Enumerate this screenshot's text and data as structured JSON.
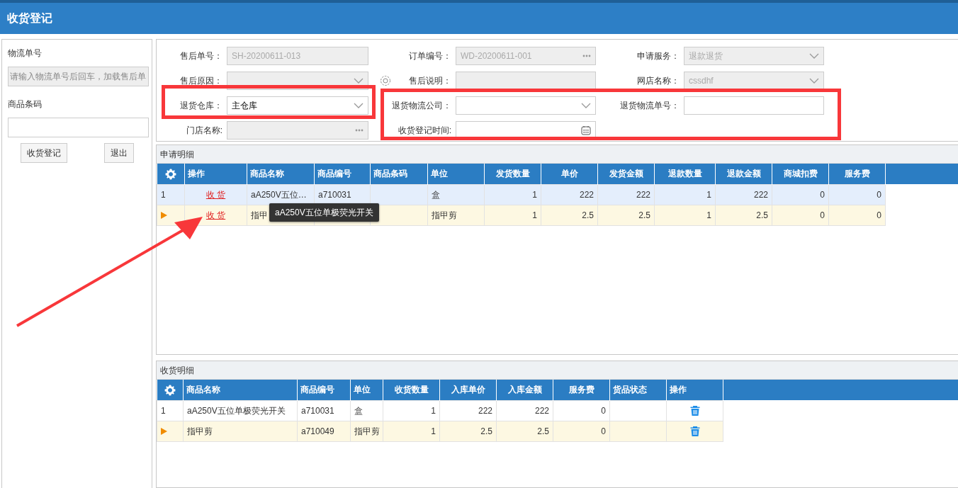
{
  "window": {
    "title": "收货登记"
  },
  "sidebar": {
    "fields": [
      {
        "label": "物流单号",
        "placeholder": "请输入物流单号后回车，加载售后单",
        "disabled": true
      },
      {
        "label": "商品条码",
        "disabled": false
      }
    ],
    "buttons": [
      "收货登记",
      "退出"
    ]
  },
  "form": {
    "fields": [
      {
        "label": "售后单号：",
        "kind": "text",
        "value": "SH-20200611-013",
        "disabled": true
      },
      {
        "label": "订单编号：",
        "kind": "lookup",
        "value": "WD-20200611-001",
        "disabled": true
      },
      {
        "label": "申请服务：",
        "kind": "select",
        "value": "退款退货",
        "disabled": true
      },
      {
        "label": "售后原因：",
        "kind": "select",
        "disabled": true
      },
      {
        "label": "售后说明：",
        "kind": "text",
        "disabled": true,
        "settings": true
      },
      {
        "label": "网店名称：",
        "kind": "select",
        "value": "cssdhf",
        "disabled": true
      },
      {
        "label": "退货仓库：",
        "kind": "select",
        "value": "主仓库",
        "disabled": false
      },
      {
        "label": "退货物流公司：",
        "kind": "select",
        "disabled": false
      },
      {
        "label": "退货物流单号：",
        "kind": "text",
        "disabled": false
      },
      {
        "label": "门店名称:",
        "kind": "lookup",
        "disabled": true
      },
      {
        "label": "收货登记时间:",
        "kind": "date",
        "disabled": false
      }
    ]
  },
  "apply_table": {
    "title": "申请明细",
    "columns": [
      {
        "label": "操作",
        "kind": "link"
      },
      {
        "label": "商品名称",
        "kind": "text"
      },
      {
        "label": "商品编号",
        "kind": "text"
      },
      {
        "label": "商品条码",
        "kind": "text"
      },
      {
        "label": "单位",
        "kind": "text"
      },
      {
        "label": "发货数量",
        "kind": "number"
      },
      {
        "label": "单价",
        "kind": "number"
      },
      {
        "label": "发货金额",
        "kind": "number"
      },
      {
        "label": "退款数量",
        "kind": "number"
      },
      {
        "label": "退款金额",
        "kind": "number"
      },
      {
        "label": "商城扣费",
        "kind": "number"
      },
      {
        "label": "服务费",
        "kind": "number"
      }
    ],
    "rows": [
      {
        "number": "1",
        "current": false,
        "highlighted": true,
        "cells": [
          "收 货",
          "aA250V五位…",
          "a710031",
          "",
          "盒",
          "1",
          "222",
          "222",
          "1",
          "222",
          "0",
          "0"
        ]
      },
      {
        "current": true,
        "highlighted": false,
        "cells": [
          "收 货",
          "指甲",
          "",
          "",
          "指甲剪",
          "1",
          "2.5",
          "2.5",
          "1",
          "2.5",
          "0",
          "0"
        ]
      }
    ],
    "tooltip": "aA250V五位单极荧光开关"
  },
  "receipt_table": {
    "title": "收货明细",
    "columns": [
      {
        "label": "商品名称",
        "kind": "text"
      },
      {
        "label": "商品编号",
        "kind": "text"
      },
      {
        "label": "单位",
        "kind": "text"
      },
      {
        "label": "收货数量",
        "kind": "number"
      },
      {
        "label": "入库单价",
        "kind": "number"
      },
      {
        "label": "入库金额",
        "kind": "number"
      },
      {
        "label": "服务费",
        "kind": "number"
      },
      {
        "label": "货品状态",
        "kind": "text"
      },
      {
        "label": "操作",
        "kind": "action"
      }
    ],
    "rows": [
      {
        "number": "1",
        "current": false,
        "highlighted": false,
        "cells": [
          "aA250V五位单极荧光开关",
          "a710031",
          "盒",
          "1",
          "222",
          "222",
          "0",
          "",
          ""
        ]
      },
      {
        "current": true,
        "highlighted": false,
        "cells": [
          "指甲剪",
          "a710049",
          "指甲剪",
          "1",
          "2.5",
          "2.5",
          "0",
          "",
          ""
        ]
      }
    ]
  },
  "annotations": [
    {
      "kind": "frame"
    },
    {
      "kind": "frame"
    },
    {
      "kind": "arrow"
    }
  ]
}
